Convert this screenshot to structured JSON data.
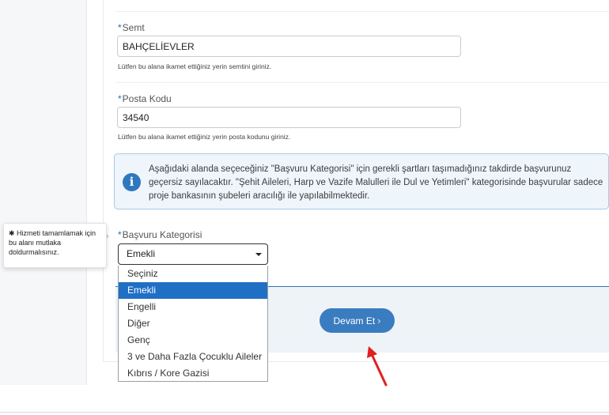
{
  "semt": {
    "required_mark": "*",
    "label": "Semt",
    "value": "BAHÇELİEVLER",
    "help": "Lütfen bu alana ikamet ettiğiniz yerin semtini giriniz."
  },
  "posta_kodu": {
    "required_mark": "*",
    "label": "Posta Kodu",
    "value": "34540",
    "help": "Lütfen bu alana ikamet ettiğiniz yerin posta kodunu giriniz."
  },
  "info": {
    "icon": "info-icon",
    "glyph": "i",
    "text": "Aşağıdaki alanda seçeceğiniz \"Başvuru Kategorisi\" için gerekli şartları taşımadığınız takdirde başvurunuz geçersiz sayılacaktır. \"Şehit Aileleri, Harp ve Vazife Malulleri ile Dul ve Yetimleri\" kategorisinde başvurular sadece proje bankasının şubeleri aracılığı ile yapılabilmektedir."
  },
  "tooltip": {
    "text": "✱ Hizmeti tamamlamak için bu alanı mutlaka doldurmalısınız.",
    "arrow": "›"
  },
  "kategori": {
    "required_mark": "*",
    "label": "Başvuru Kategorisi",
    "selected": "Emekli",
    "options": [
      "Seçiniz",
      "Emekli",
      "Engelli",
      "Diğer",
      "Genç",
      "3 ve Daha Fazla Çocuklu Aileler",
      "Kıbrıs / Kore Gazisi"
    ]
  },
  "continue_button": {
    "label": "Devam Et",
    "chevron": "›"
  },
  "colors": {
    "accent": "#3a7cc0",
    "selected_option": "#1f6fc5",
    "annotation_arrow": "#e02020"
  }
}
